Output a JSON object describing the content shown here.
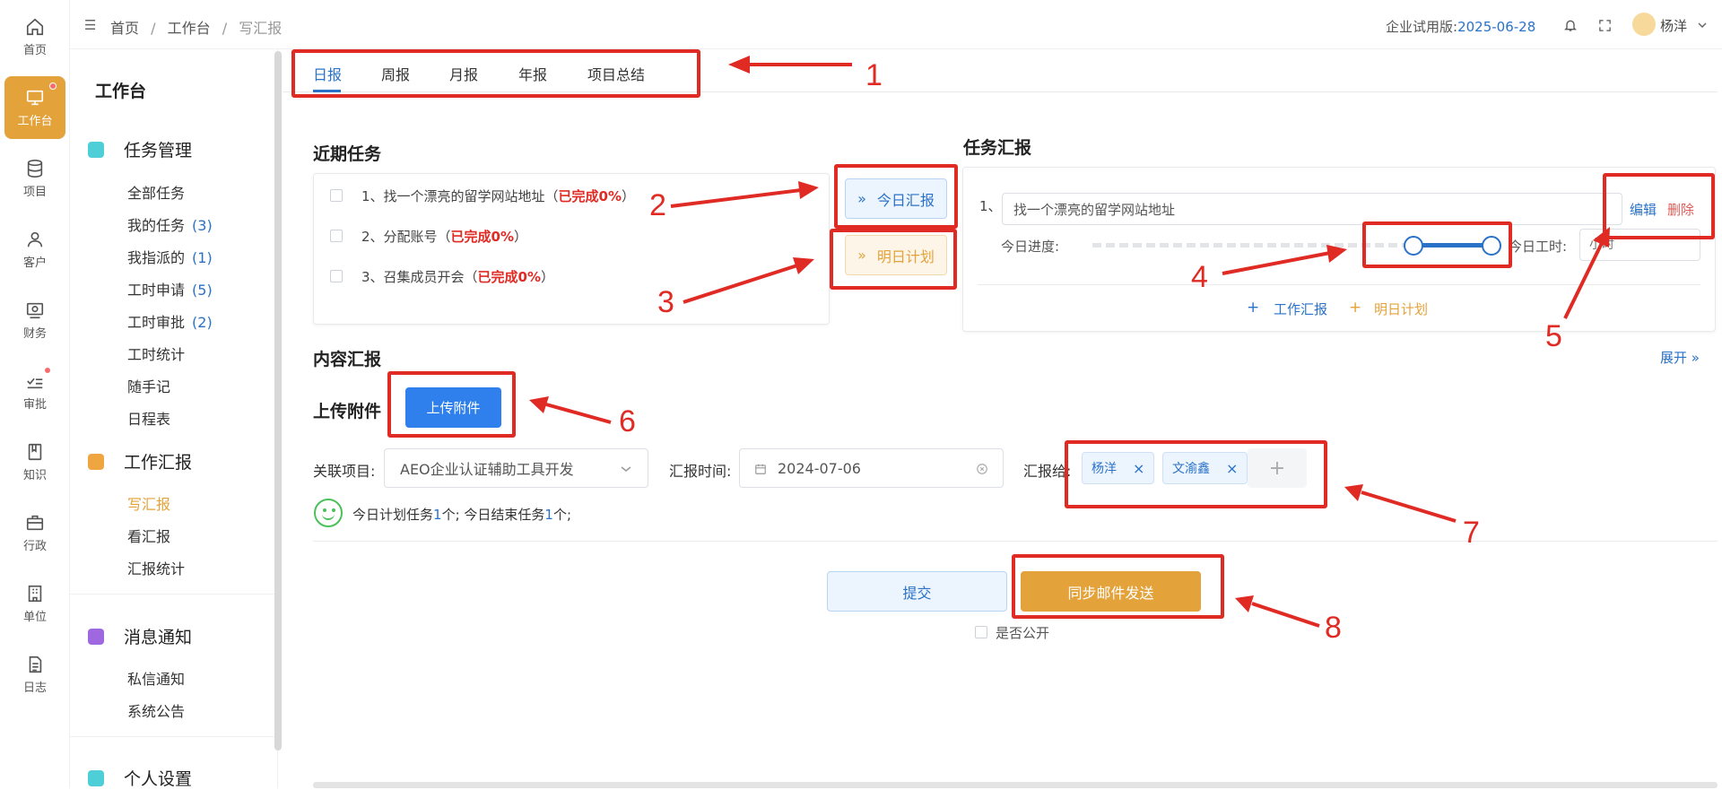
{
  "rail": [
    {
      "label": "首页",
      "icon": "home-icon"
    },
    {
      "label": "工作台",
      "icon": "monitor-icon",
      "active": true,
      "dot": true
    },
    {
      "label": "项目",
      "icon": "database-icon"
    },
    {
      "label": "客户",
      "icon": "user-icon"
    },
    {
      "label": "财务",
      "icon": "finance-icon"
    },
    {
      "label": "审批",
      "icon": "approve-icon",
      "dot": true
    },
    {
      "label": "知识",
      "icon": "book-icon"
    },
    {
      "label": "行政",
      "icon": "briefcase-icon"
    },
    {
      "label": "单位",
      "icon": "building-icon"
    },
    {
      "label": "日志",
      "icon": "document-icon"
    }
  ],
  "sidebar": {
    "title": "工作台",
    "groups": [
      {
        "label": "任务管理",
        "icon": "grid-icon",
        "color": "#4ecfd8",
        "items": [
          {
            "label": "全部任务",
            "count": ""
          },
          {
            "label": "我的任务",
            "count": "(3)"
          },
          {
            "label": "我指派的",
            "count": "(1)"
          },
          {
            "label": "工时申请",
            "count": "(5)"
          },
          {
            "label": "工时审批",
            "count": "(2)"
          },
          {
            "label": "工时统计",
            "count": ""
          },
          {
            "label": "随手记",
            "count": ""
          },
          {
            "label": "日程表",
            "count": ""
          }
        ]
      },
      {
        "label": "工作汇报",
        "icon": "edit-note-icon",
        "color": "#f0a640",
        "items": [
          {
            "label": "写汇报",
            "count": "",
            "current": true
          },
          {
            "label": "看汇报",
            "count": ""
          },
          {
            "label": "汇报统计",
            "count": ""
          }
        ]
      },
      {
        "label": "消息通知",
        "icon": "message-icon",
        "color": "#a068e0",
        "items": [
          {
            "label": "私信通知",
            "count": ""
          },
          {
            "label": "系统公告",
            "count": ""
          }
        ]
      },
      {
        "label": "个人设置",
        "icon": "grid-icon",
        "color": "#4ecfd8",
        "items": []
      }
    ]
  },
  "header": {
    "breadcrumb": [
      "首页",
      "工作台",
      "写汇报"
    ],
    "edition_label": "企业试用版:",
    "edition_date": "2025-06-28",
    "user": "杨洋"
  },
  "tabs": [
    "日报",
    "周报",
    "月报",
    "年报",
    "项目总结"
  ],
  "recent": {
    "title": "近期任务",
    "tasks": [
      {
        "text": "1、找一个漂亮的留学网站地址（",
        "status": "已完成0%",
        "end": "）"
      },
      {
        "text": "2、分配账号（",
        "status": "已完成0%",
        "end": "）"
      },
      {
        "text": "3、召集成员开会（",
        "status": "已完成0%",
        "end": "）"
      }
    ],
    "today_button": "今日汇报",
    "tomorrow_button": "明日计划"
  },
  "report": {
    "title": "任务汇报",
    "index": "1、",
    "task_value": "找一个漂亮的留学网站地址",
    "progress_label": "今日进度:",
    "hours_label": "今日工时:",
    "hours_placeholder": "小时",
    "edit": "编辑",
    "delete": "删除",
    "add_work": "工作汇报",
    "add_plan": "明日计划"
  },
  "content": {
    "title": "内容汇报",
    "expand": "展开",
    "upload_label": "上传附件",
    "upload_button": "上传附件",
    "project_label": "关联项目:",
    "project_value": "AEO企业认证辅助工具开发",
    "time_label": "汇报时间:",
    "time_value": "2024-07-06",
    "to_label": "汇报给:",
    "recipients": [
      "杨洋",
      "文渝鑫"
    ],
    "summary_a": "今日计划任务",
    "summary_n1": "1",
    "summary_b": "个; 今日结束任务",
    "summary_n2": "1",
    "summary_c": "个;",
    "submit": "提交",
    "send_mail": "同步邮件发送",
    "public": "是否公开"
  },
  "annotations": [
    "1",
    "2",
    "3",
    "4",
    "5",
    "6",
    "7",
    "8"
  ],
  "colors": {
    "accent": "#2a72c8",
    "orange": "#e4a23a",
    "red": "#e02a24"
  }
}
